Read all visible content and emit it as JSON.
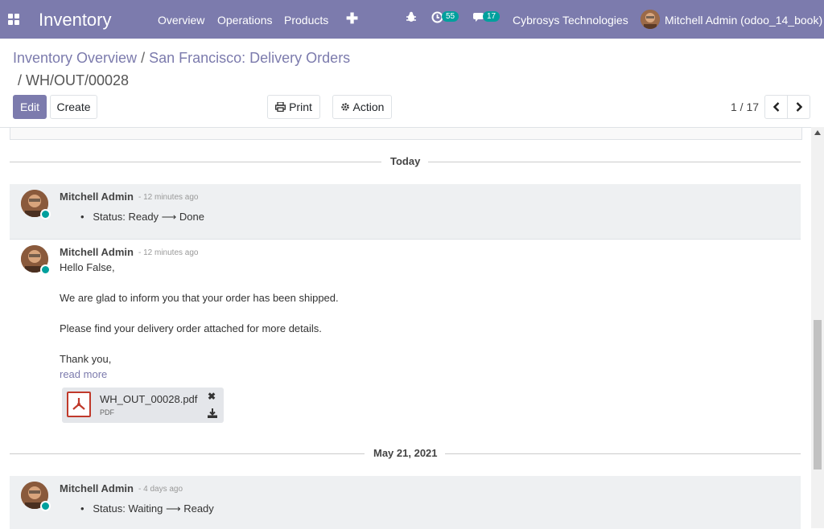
{
  "topbar": {
    "app_name": "Inventory",
    "menus": [
      "Overview",
      "Operations",
      "Products"
    ],
    "activity_count": "55",
    "message_count": "17",
    "company": "Cybrosys Technologies",
    "user": "Mitchell Admin (odoo_14_book)"
  },
  "breadcrumb": {
    "item1": "Inventory Overview",
    "item2": "San Francisco: Delivery Orders",
    "current": "WH/OUT/00028",
    "separator": "/"
  },
  "toolbar": {
    "edit": "Edit",
    "create": "Create",
    "print": "Print",
    "action": "Action",
    "pager": "1 / 17"
  },
  "chatter": {
    "day1": "Today",
    "day2": "May 21, 2021",
    "messages": [
      {
        "author": "Mitchell Admin",
        "time": "- 12 minutes ago",
        "tracking": "Status: Ready ⟶ Done"
      },
      {
        "author": "Mitchell Admin",
        "time": "- 12 minutes ago",
        "body": [
          "Hello False,",
          "We are glad to inform you that your order has been shipped.",
          "Please find your delivery order attached for more details.",
          "Thank you,"
        ],
        "read_more": "read more",
        "attachment": {
          "name": "WH_OUT_00028.pdf",
          "type": "PDF"
        }
      },
      {
        "author": "Mitchell Admin",
        "time": "- 4 days ago",
        "tracking": "Status: Waiting ⟶ Ready"
      }
    ]
  },
  "colors": {
    "brand": "#7c7bad",
    "online": "#00a09d",
    "note_bg": "#eef0f2"
  }
}
